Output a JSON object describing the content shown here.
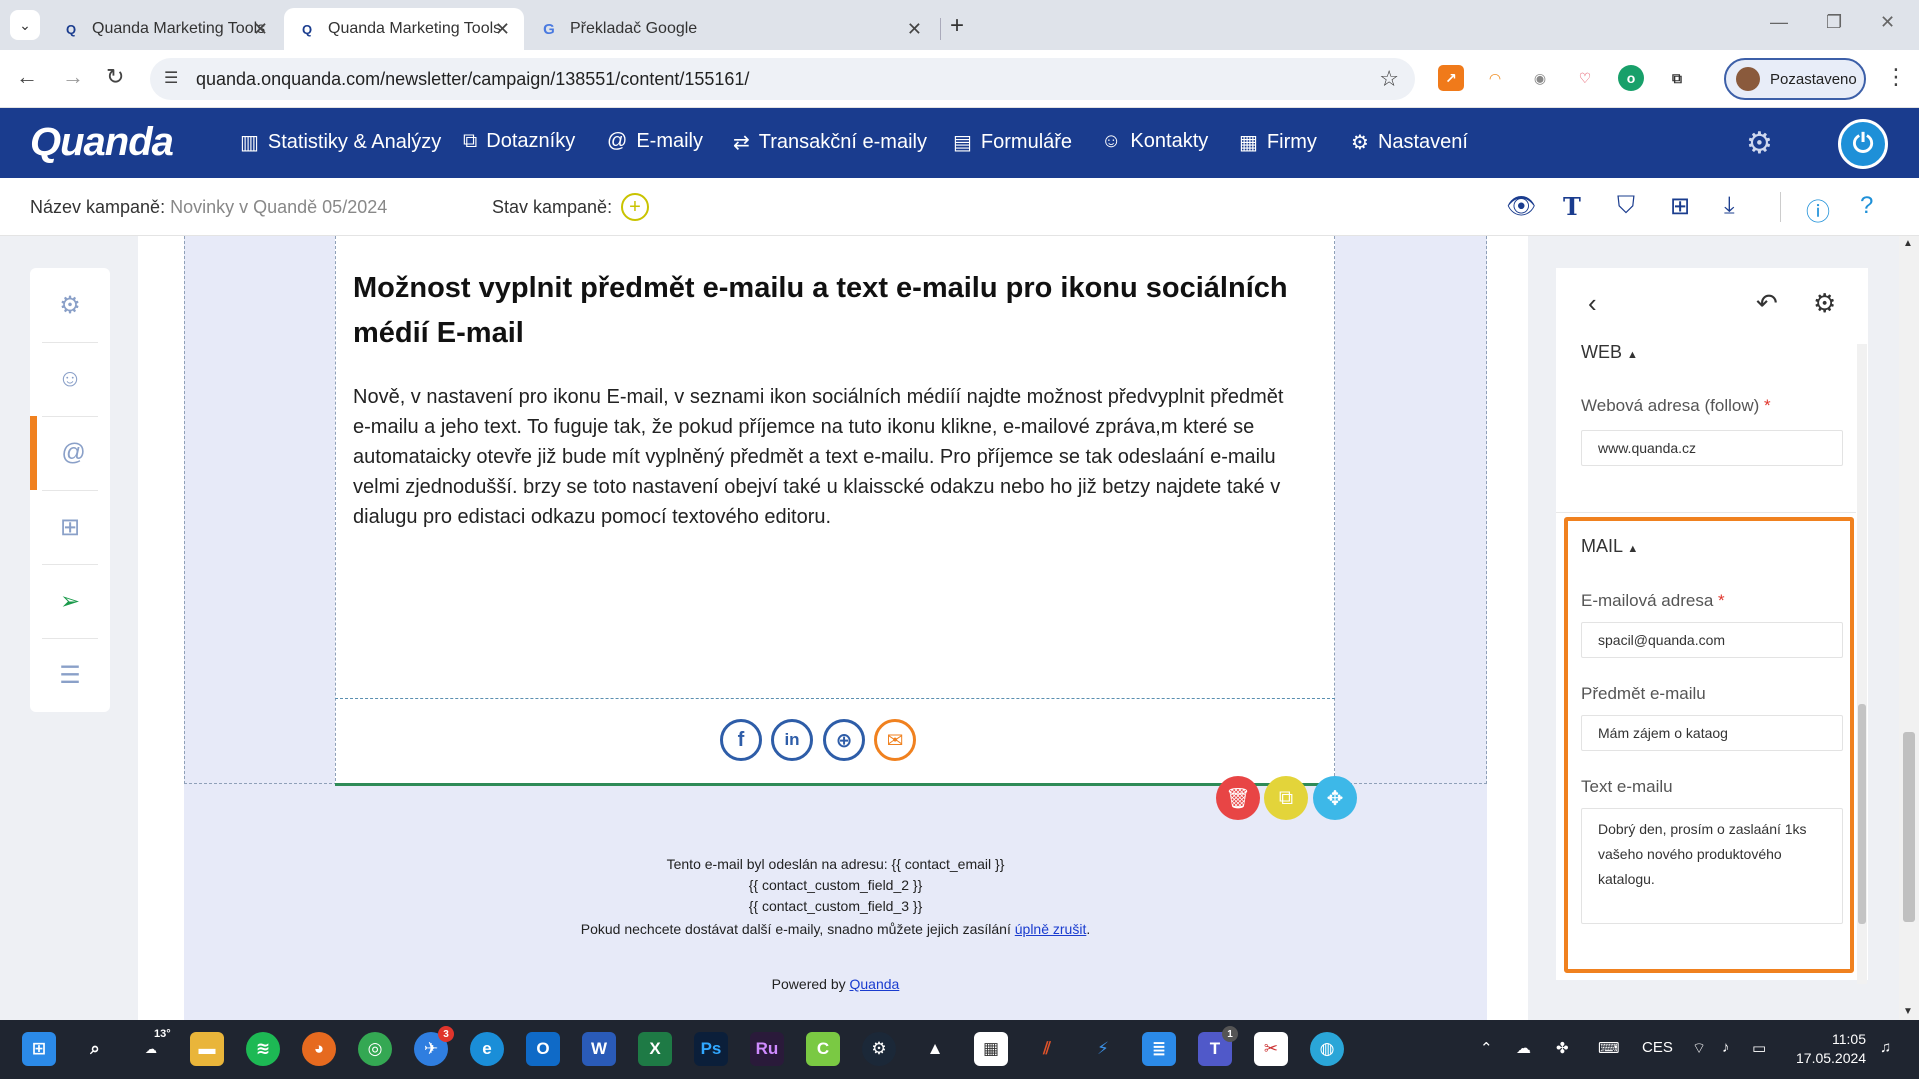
{
  "browser": {
    "tabs": [
      {
        "title": "Quanda Marketing Tools",
        "active": false
      },
      {
        "title": "Quanda Marketing Tools",
        "active": true
      },
      {
        "title": "Překladač Google",
        "active": false
      }
    ],
    "url": "quanda.onquanda.com/newsletter/campaign/138551/content/155161/",
    "profile_label": "Pozastaveno"
  },
  "app": {
    "logo": "Quanda",
    "menu": [
      {
        "label": "Statistiky & Analýzy",
        "icon": "chart-icon"
      },
      {
        "label": "Dotazníky",
        "icon": "survey-icon"
      },
      {
        "label": "E-maily",
        "icon": "at-icon"
      },
      {
        "label": "Transakční e-maily",
        "icon": "flow-icon"
      },
      {
        "label": "Formuláře",
        "icon": "form-icon"
      },
      {
        "label": "Kontakty",
        "icon": "contacts-icon"
      },
      {
        "label": "Firmy",
        "icon": "building-icon"
      },
      {
        "label": "Nastavení",
        "icon": "gear-icon"
      }
    ]
  },
  "campaign": {
    "name_label": "Název kampaně:",
    "name_value": "Novinky v Quandě 05/2024",
    "state_label": "Stav kampaně:"
  },
  "email": {
    "title": "Možnost vyplnit předmět e-mailu a text e-mailu pro ikonu sociálních médií E-mail",
    "body": "Nově, v nastavení pro ikonu E-mail, v seznami ikon sociálních médiíí najdte možnost předvyplnit předmět e-mailu a jeho text. To fuguje tak, že pokud příjemce na tuto ikonu klikne, e-mailové zpráva,m které se automataicky otevře již bude mít vyplněný předmět a text e-mailu. Pro příjemce se tak odeslaání e-mailu velmi zjednodušší. brzy se toto nastavení obejví také u klaisscké odakzu nebo ho již betzy najdete také v dialugu pro edistaci odkazu pomocí textového editoru.",
    "footer": {
      "line1": "Tento e-mail byl odeslán na adresu: {{ contact_email }}",
      "line2": "{{ contact_custom_field_2 }}",
      "line3": "{{ contact_custom_field_3 }}",
      "line4_text": "Pokud nechcete dostávat další e-maily, snadno můžete jejich zasílání",
      "line4_link": "úplně zrušit",
      "line4_end": ".",
      "powered_text": "Powered by",
      "powered_link": "Quanda"
    }
  },
  "panel": {
    "web_section": "WEB",
    "web_label": "Webová adresa (follow)",
    "web_value": "www.quanda.cz",
    "mail_section": "MAIL",
    "email_label": "E-mailová adresa",
    "email_value": "spacil@quanda.com",
    "subject_label": "Předmět e-mailu",
    "subject_value": "Mám zájem o kataog",
    "text_label": "Text e-mailu",
    "text_value": "Dobrý den, prosím o zaslaání 1ks vašeho nového produktového katalogu.",
    "required_mark": "*"
  },
  "taskbar": {
    "weather": "13°",
    "lang": "CES",
    "time": "11:05",
    "date": "17.05.2024",
    "badge_mail": "3",
    "badge_teams": "1"
  },
  "colors": {
    "brand": "#1a3c8e",
    "accent": "#f0811f",
    "delete": "#e84545",
    "duplicate": "#e3d43a",
    "move": "#3db8e8"
  }
}
